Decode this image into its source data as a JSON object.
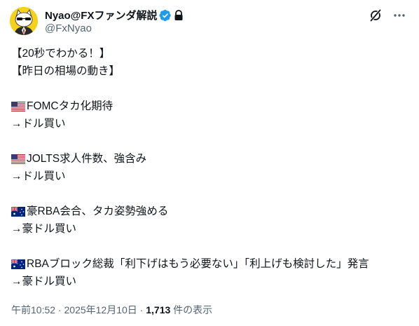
{
  "author": {
    "display_name": "Nyao@FXファンダ解説",
    "handle": "@FxNyao"
  },
  "post": {
    "lines": [
      {
        "flag": "",
        "text": "【20秒でわかる！】"
      },
      {
        "flag": "",
        "text": "【昨日の相場の動き】"
      },
      {
        "flag": "",
        "text": ""
      },
      {
        "flag": "us",
        "text": "FOMCタカ化期待"
      },
      {
        "flag": "",
        "text": "→ドル買い"
      },
      {
        "flag": "",
        "text": ""
      },
      {
        "flag": "us",
        "text": "JOLTS求人件数、強含み"
      },
      {
        "flag": "",
        "text": "→ドル買い"
      },
      {
        "flag": "",
        "text": ""
      },
      {
        "flag": "au",
        "text": "豪RBA会合、タカ姿勢強める"
      },
      {
        "flag": "",
        "text": "→豪ドル買い"
      },
      {
        "flag": "",
        "text": ""
      },
      {
        "flag": "au",
        "text": "RBAブロック総裁「利下げはもう必要ない」「利上げも検討した」発言"
      },
      {
        "flag": "",
        "text": "→豪ドル買い"
      }
    ]
  },
  "meta": {
    "time": "午前10:52",
    "separator": " · ",
    "date": "2025年12月10日",
    "views_count": "1,713",
    "views_label": " 件の表示"
  },
  "colors": {
    "text": "#0f1419",
    "secondary": "#536471",
    "verified": "#1d9bf0",
    "avatar_bg": "#f4d21a"
  },
  "icons": {
    "verified": "verified-badge-icon",
    "lock": "lock-icon",
    "grok": "grok-icon",
    "more": "more-icon"
  }
}
